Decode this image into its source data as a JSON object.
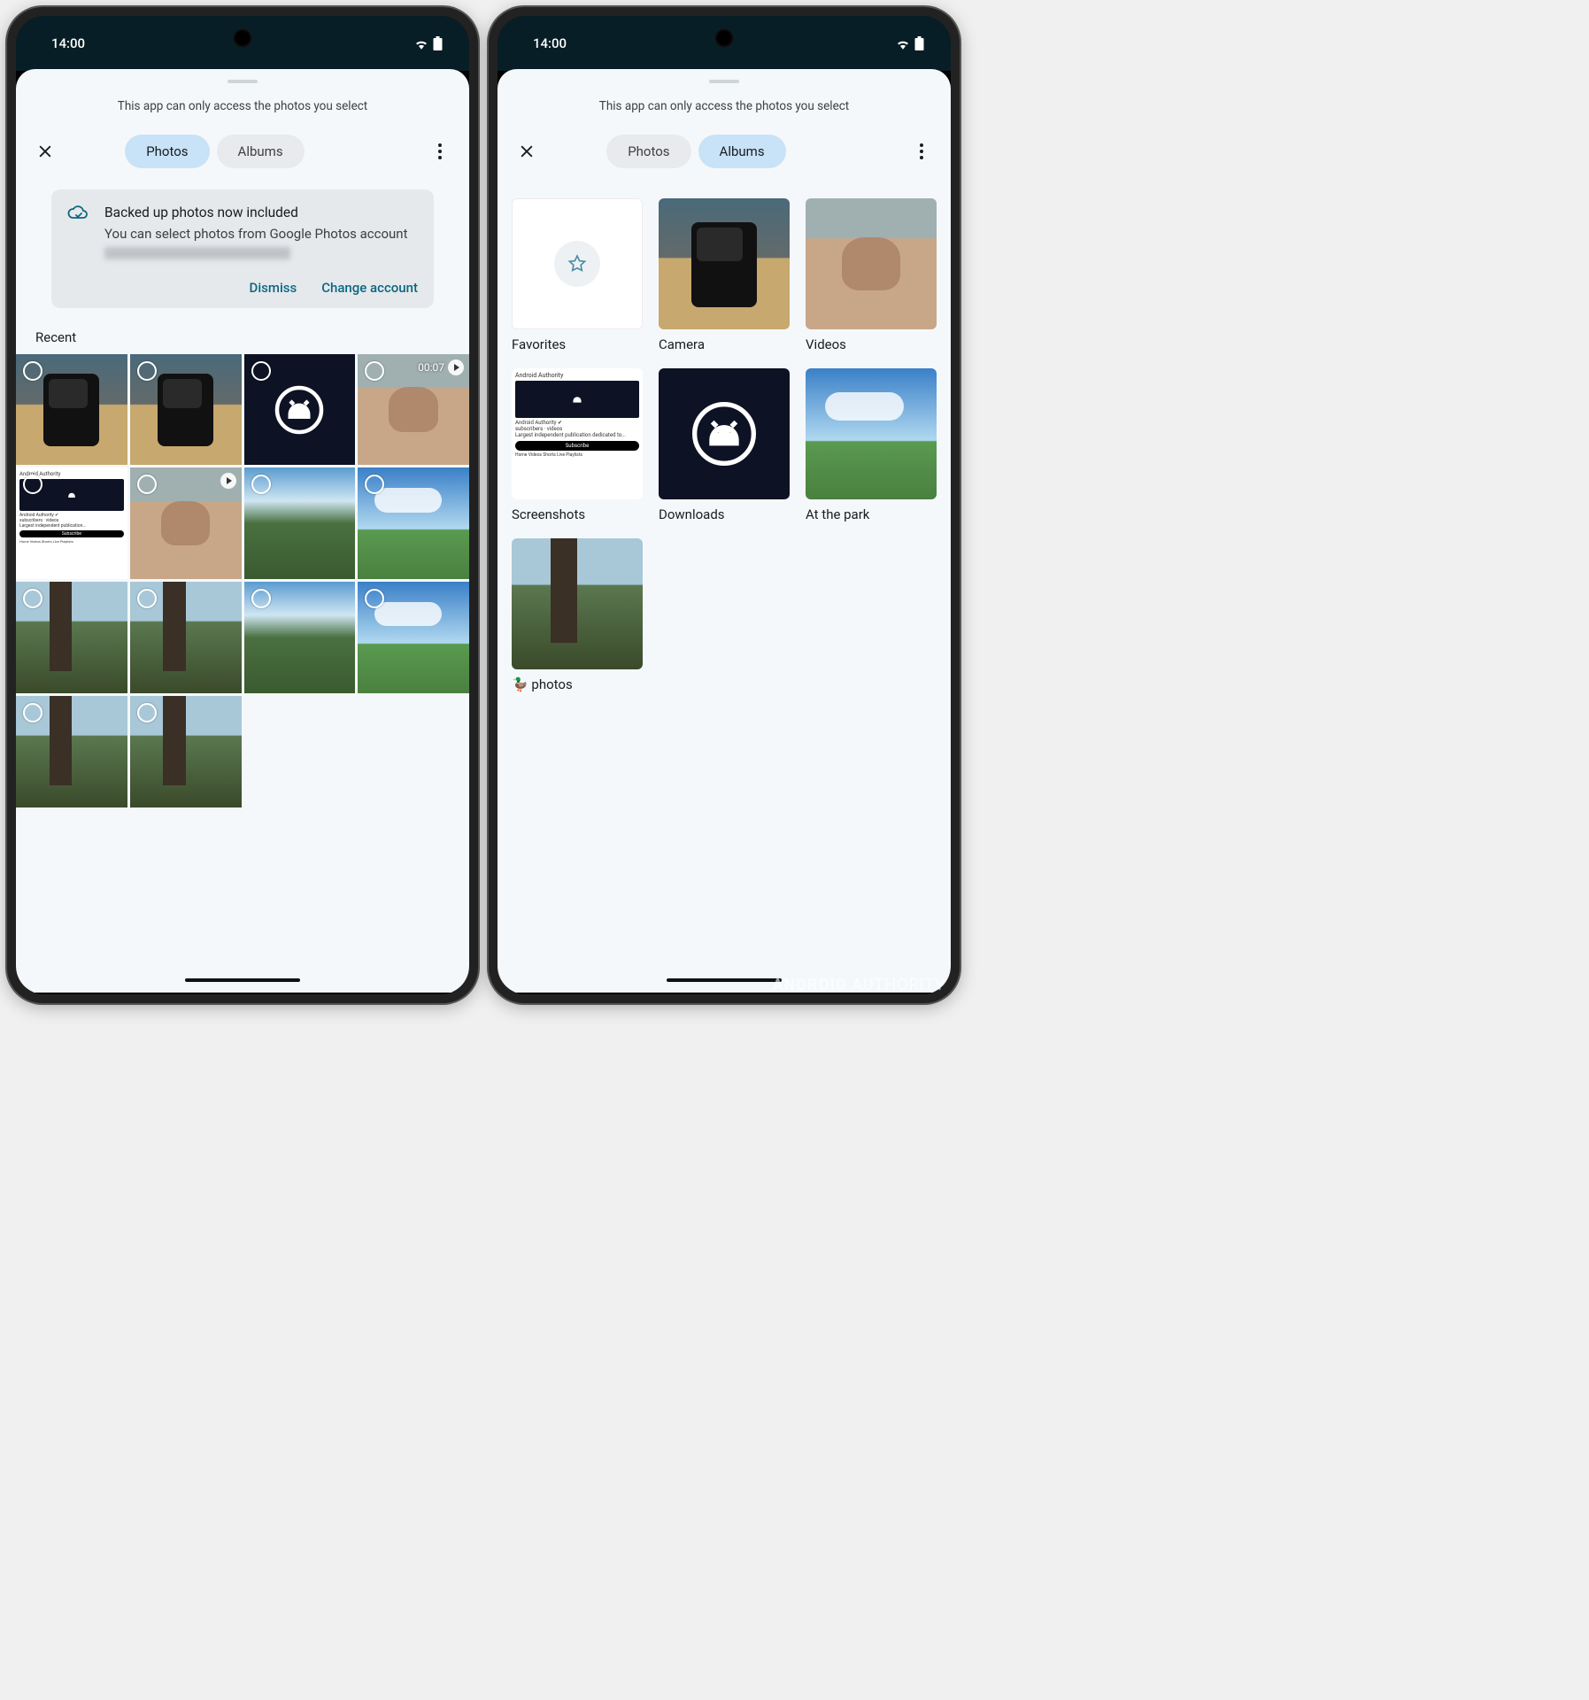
{
  "status": {
    "time": "14:00"
  },
  "notice": "This app can only access the photos you select",
  "tabs": {
    "photos": "Photos",
    "albums": "Albums"
  },
  "info": {
    "title": "Backed up photos now included",
    "body": "You can select photos from Google Photos account",
    "dismiss": "Dismiss",
    "change": "Change account"
  },
  "section_recent": "Recent",
  "video_duration": "00:07",
  "albums": {
    "favorites": "Favorites",
    "camera": "Camera",
    "videos": "Videos",
    "screenshots": "Screenshots",
    "downloads": "Downloads",
    "park": "At the park",
    "duckphotos": "🦆 photos"
  },
  "watermark_a": "ANDROID",
  "watermark_b": " AUTHORITY"
}
